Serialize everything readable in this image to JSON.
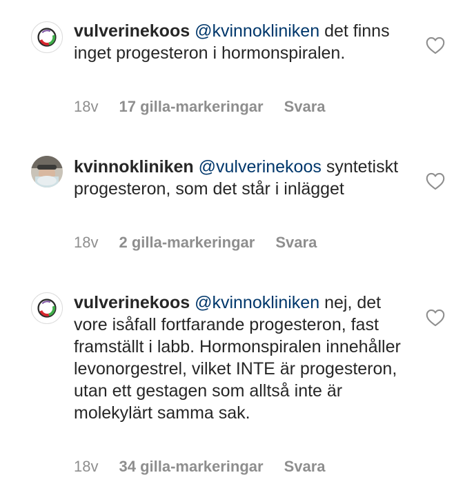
{
  "comments": [
    {
      "username": "vulverinekoos",
      "mention": "@kvinnokliniken",
      "text": "det finns inget progesteron i hormonspiralen.",
      "time": "18v",
      "likes": "17 gilla-markeringar",
      "reply": "Svara"
    },
    {
      "username": "kvinnokliniken",
      "mention": "@vulverinekoos",
      "text": "syntetiskt progesteron, som det står i inlägget",
      "time": "18v",
      "likes": "2 gilla-markeringar",
      "reply": "Svara"
    },
    {
      "username": "vulverinekoos",
      "mention": "@kvinnokliniken",
      "text": "nej, det vore isåfall fortfarande progesteron, fast framställt i labb. Hormonspiralen innehåller levonorgestrel, vilket INTE är progesteron, utan ett gestagen som alltså inte är molekylärt samma sak.",
      "time": "18v",
      "likes": "34 gilla-markeringar",
      "reply": "Svara"
    }
  ],
  "icons": {
    "like": "heart-outline-icon",
    "avatar_vulverinekoos": "logo-avatar",
    "avatar_kvinnokliniken": "photo-avatar"
  },
  "colors": {
    "text": "#262626",
    "mention": "#00376b",
    "meta": "#8e8e8e"
  }
}
